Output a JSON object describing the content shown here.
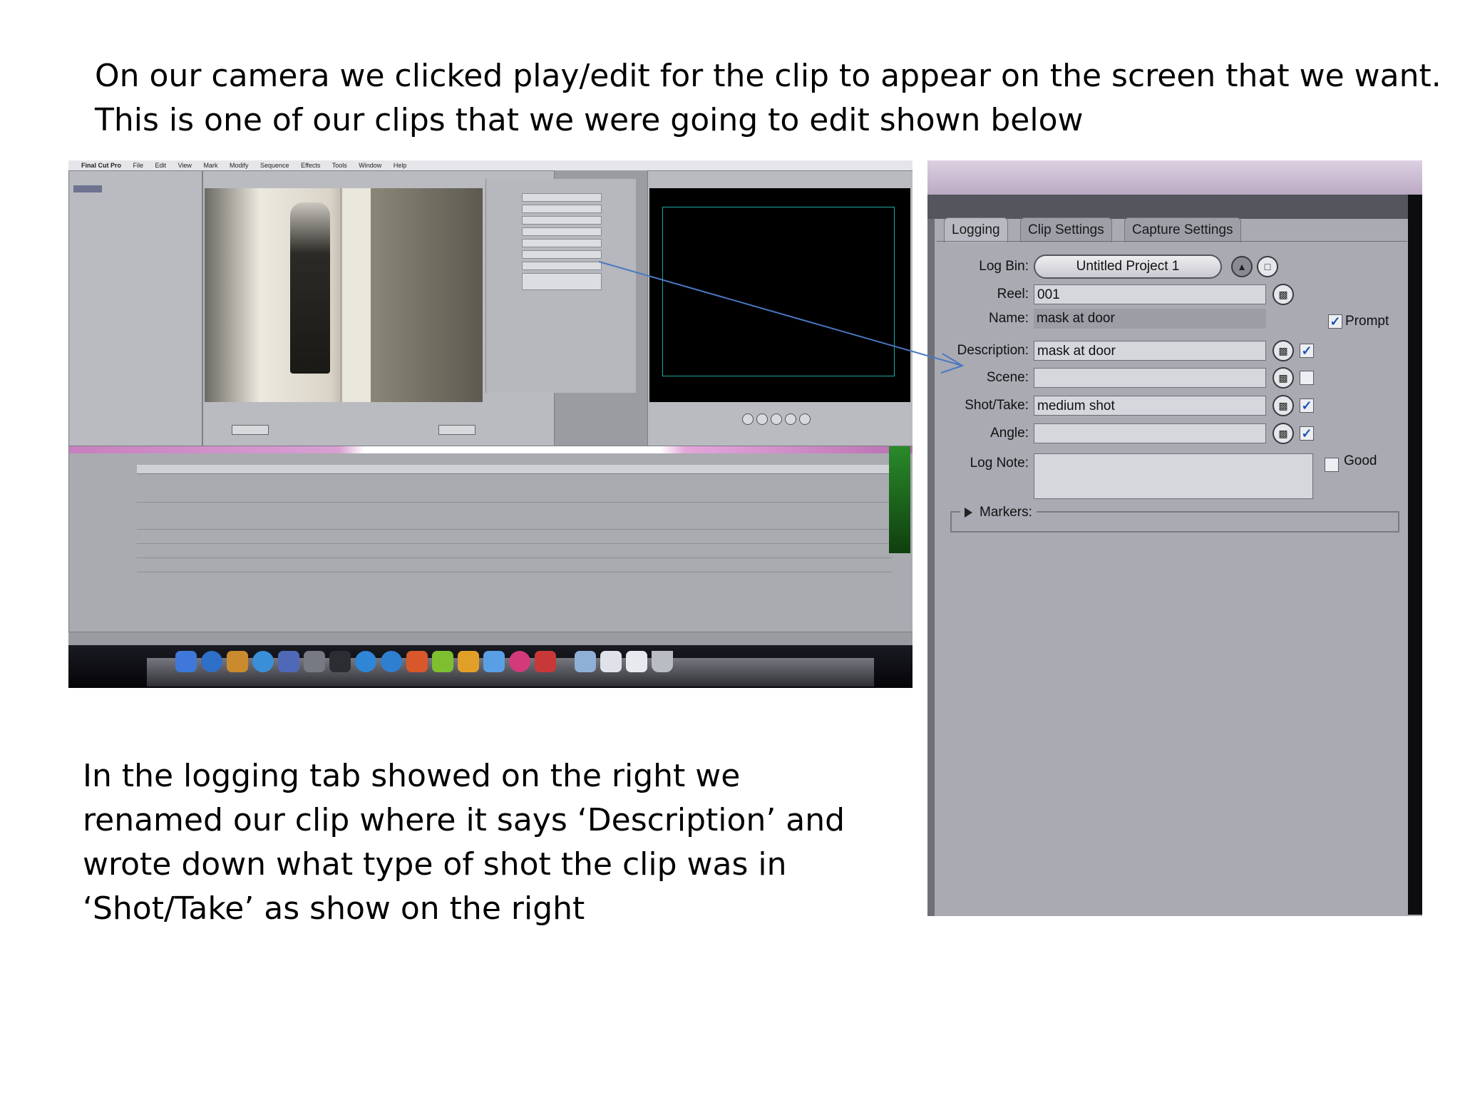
{
  "intro": {
    "line1": "On our camera we clicked play/edit for the clip to appear on the screen that we want.",
    "line2": "This is one of our clips that we were going to edit shown below"
  },
  "body_text": {
    "line1": "In the logging tab showed on the right we",
    "line2": "renamed our clip where it says ‘Description’ and",
    "line3": "wrote down what type of shot the clip was in",
    "line4": "‘Shot/Take’ as show on the right"
  },
  "fcp_screenshot": {
    "menubar": {
      "app": "Final Cut Pro",
      "items": [
        "File",
        "Edit",
        "View",
        "Mark",
        "Modify",
        "Sequence",
        "Effects",
        "Tools",
        "Window",
        "Help"
      ]
    }
  },
  "logging_panel": {
    "tabs": [
      "Logging",
      "Clip Settings",
      "Capture Settings"
    ],
    "log_bin": {
      "label": "Log Bin:",
      "value": "Untitled Project 1"
    },
    "reel": {
      "label": "Reel:",
      "value": "001"
    },
    "name": {
      "label": "Name:",
      "value": "mask at door"
    },
    "prompt": {
      "label": "Prompt",
      "checked": true
    },
    "description": {
      "label": "Description:",
      "value": "mask at door",
      "checked": true
    },
    "scene": {
      "label": "Scene:",
      "value": "",
      "checked": false
    },
    "shot_take": {
      "label": "Shot/Take:",
      "value": "medium shot",
      "checked": true
    },
    "angle": {
      "label": "Angle:",
      "value": "",
      "checked": true
    },
    "log_note": {
      "label": "Log Note:",
      "value": ""
    },
    "good": {
      "label": "Good",
      "checked": false
    },
    "markers": {
      "label": "Markers:"
    }
  },
  "colors": {
    "arrow": "#4a78c2",
    "panel_bg": "#a9aab2",
    "check_color": "#1b4fb8"
  }
}
